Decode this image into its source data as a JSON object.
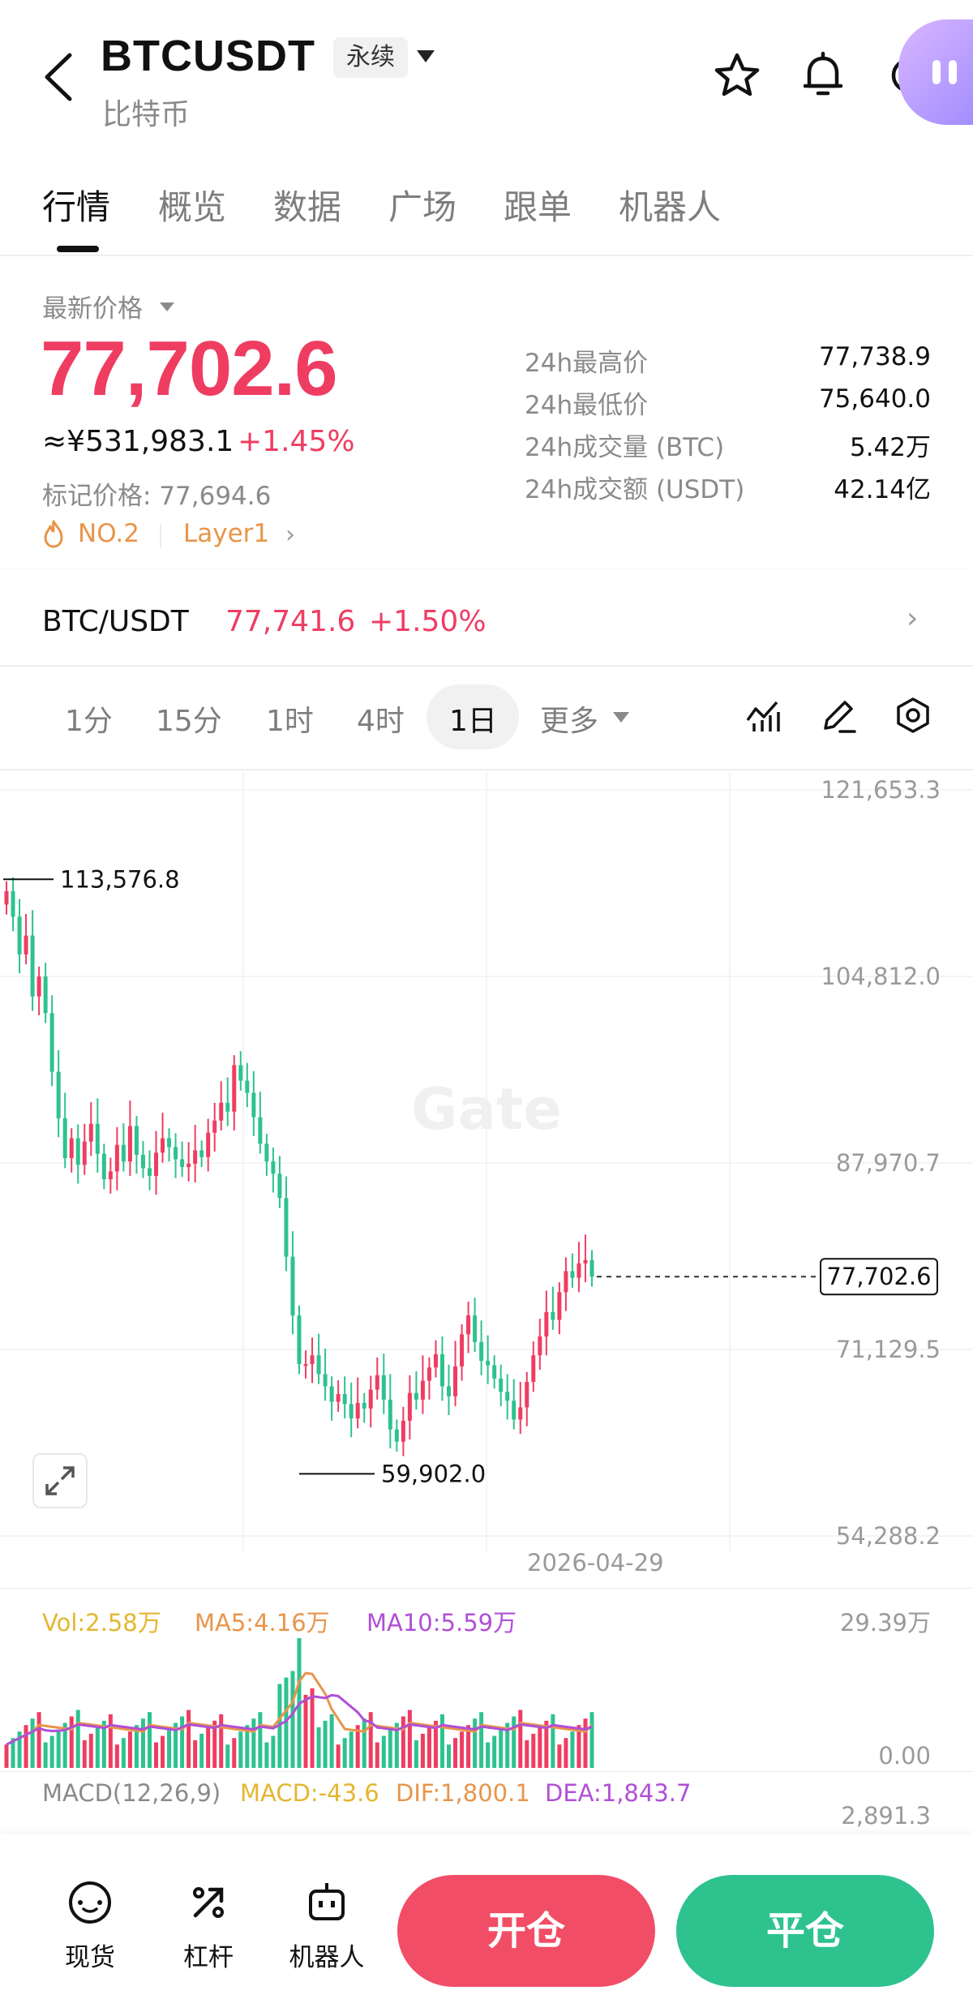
{
  "header": {
    "symbol": "BTCUSDT",
    "contract_type": "永续",
    "subtitle": "比特币"
  },
  "tabs": [
    "行情",
    "概览",
    "数据",
    "广场",
    "跟单",
    "机器人"
  ],
  "price": {
    "latest_label": "最新价格",
    "last": "77,702.6",
    "cny": "≈¥531,983.1",
    "change": "+1.45%",
    "mark": "标记价格: 77,694.6",
    "rank": "NO.2",
    "sector": "Layer1"
  },
  "stats": [
    {
      "label": "24h最高价",
      "value": "77,738.9"
    },
    {
      "label": "24h最低价",
      "value": "75,640.0"
    },
    {
      "label": "24h成交量 (BTC)",
      "value": "5.42万"
    },
    {
      "label": "24h成交额 (USDT)",
      "value": "42.14亿"
    }
  ],
  "spot": {
    "pair": "BTC/USDT",
    "price": "77,741.6",
    "change": "+1.50%"
  },
  "timeframes": {
    "items": [
      "1分",
      "15分",
      "1时",
      "4时",
      "1日"
    ],
    "active": "1日",
    "more": "更多"
  },
  "chart": {
    "watermark": "Gate",
    "date_label": "2026-04-29",
    "high_marker": "113,576.8",
    "low_marker": "59,902.0",
    "current_marker": "77,702.6",
    "y_ticks": [
      "121,653.3",
      "104,812.0",
      "87,970.7",
      "71,129.5",
      "54,288.2"
    ]
  },
  "chart_data": {
    "type": "candlestick",
    "y_range": [
      54288.2,
      121653.3
    ],
    "y_ticks": [
      121653.3,
      104812.0,
      87970.7,
      71129.5,
      54288.2
    ],
    "marked_high": 113576.8,
    "marked_low": 59902.0,
    "last": 77702.6,
    "x_label": "2026-04-29",
    "closes": [
      112500,
      110200,
      106800,
      108500,
      103000,
      104800,
      101500,
      96200,
      92000,
      88400,
      90200,
      87800,
      89900,
      91500,
      88800,
      86500,
      87200,
      89600,
      88100,
      91300,
      88700,
      87500,
      86800,
      88900,
      90200,
      89400,
      88300,
      87600,
      87900,
      89100,
      88500,
      90700,
      91800,
      93400,
      92600,
      96800,
      95400,
      94300,
      92100,
      89700,
      88100,
      87000,
      84800,
      79500,
      74200,
      69800,
      69800,
      70600,
      68900,
      67800,
      66400,
      67100,
      66200,
      64900,
      66300,
      65800,
      67500,
      68800,
      66600,
      63900,
      62800,
      64700,
      67200,
      66600,
      68300,
      69500,
      70700,
      67800,
      66900,
      69600,
      72500,
      74200,
      71800,
      70100,
      69700,
      68500,
      67300,
      66500,
      64800,
      65900,
      68200,
      70600,
      72300,
      74500,
      73800,
      76300,
      78200,
      77600,
      78900,
      79200,
      77702.6
    ],
    "volume": {
      "max_label": "29.39万",
      "min_label": "0.00",
      "vol": "2.58万",
      "ma5": "4.16万",
      "ma10": "5.59万"
    },
    "macd": {
      "params": "MACD(12,26,9)",
      "macd": -43.6,
      "dif": 1800.1,
      "dea": 1843.7,
      "axis_top": "2,891.3"
    }
  },
  "indicators": {
    "vol": "Vol:2.58万",
    "ma5": "MA5:4.16万",
    "ma10": "MA10:5.59万",
    "vol_max": "29.39万",
    "vol_min": "0.00",
    "macd_params": "MACD(12,26,9)",
    "macd": "MACD:-43.6",
    "dif": "DIF:1,800.1",
    "dea": "DEA:1,843.7",
    "macd_axis": "2,891.3"
  },
  "bottom_nav": [
    {
      "label": "现货",
      "icon": "spot-icon"
    },
    {
      "label": "杠杆",
      "icon": "leverage-icon"
    },
    {
      "label": "机器人",
      "icon": "robot-icon"
    }
  ],
  "actions": {
    "open": "开仓",
    "close": "平仓"
  },
  "colors": {
    "up": "#ef3d62",
    "down": "#2ec28f",
    "accent_orange": "#e8954a",
    "ma5": "#e8954a",
    "ma10": "#b04fd6",
    "vol": "#e4b630"
  }
}
